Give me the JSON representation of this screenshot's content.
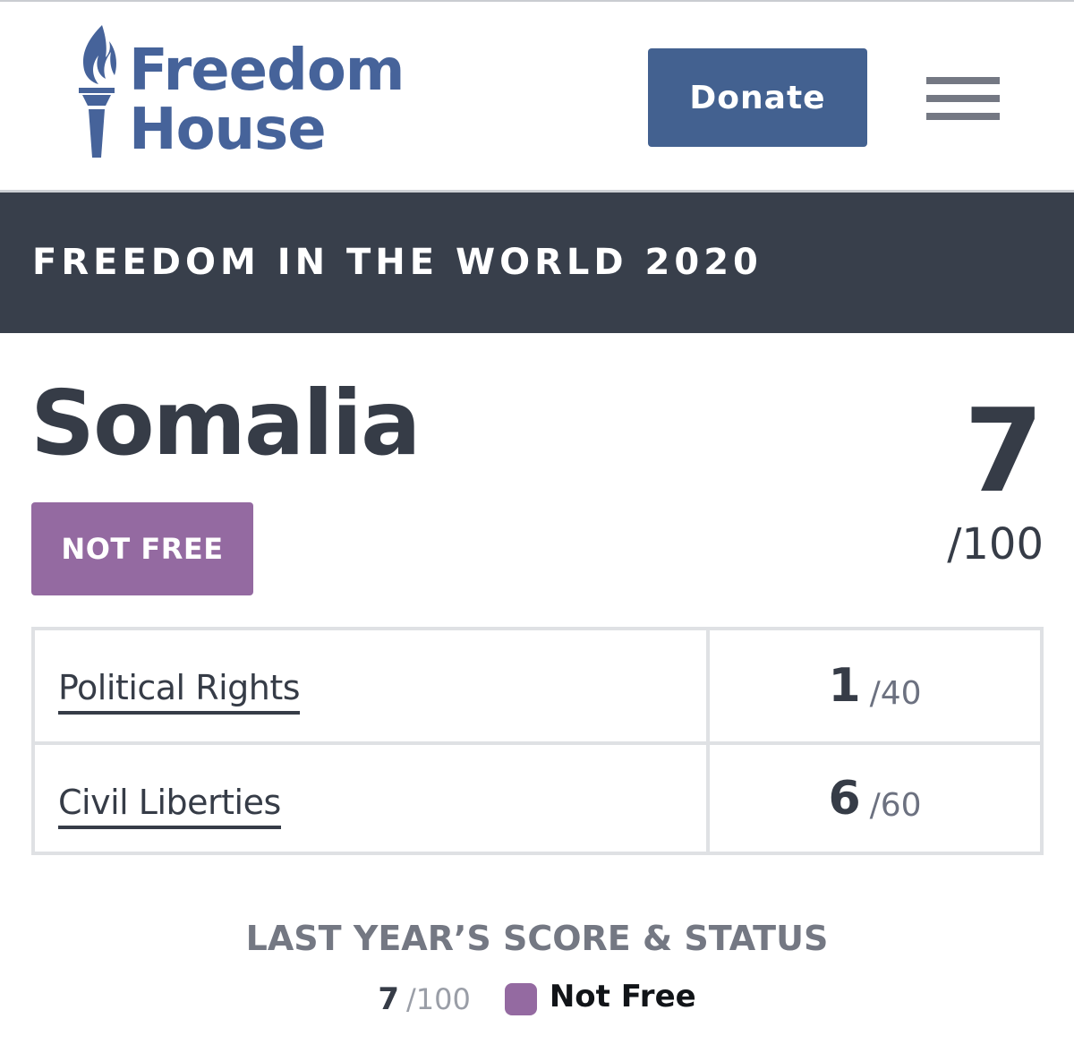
{
  "colors": {
    "brand_blue": "#436190",
    "banner_bg": "#383f4b",
    "not_free_purple": "#946aa1",
    "text_dark": "#363c47",
    "border_gray": "#dfe1e4"
  },
  "header": {
    "logo": {
      "line1": "Freedom",
      "line2": "House",
      "icon": "torch-icon"
    },
    "donate_label": "Donate",
    "menu_icon": "hamburger-menu-icon"
  },
  "banner": {
    "title": "FREEDOM IN THE WORLD 2020"
  },
  "country": {
    "name": "Somalia",
    "status": "NOT FREE",
    "score": "7",
    "score_max": "/100"
  },
  "scores": [
    {
      "label": "Political Rights",
      "value": "1",
      "max": "/40"
    },
    {
      "label": "Civil Liberties",
      "value": "6",
      "max": "/60"
    }
  ],
  "last_year": {
    "title": "LAST YEAR’S SCORE & STATUS",
    "score": "7",
    "score_max": "/100",
    "status": "Not Free"
  }
}
